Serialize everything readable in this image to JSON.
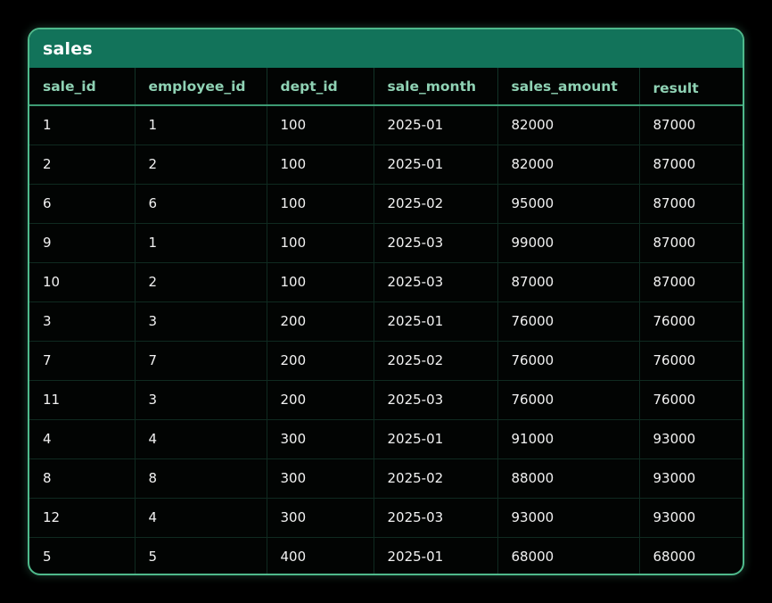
{
  "table": {
    "title": "sales",
    "columns": [
      "sale_id",
      "employee_id",
      "dept_id",
      "sale_month",
      "sales_amount",
      "result"
    ],
    "rows": [
      [
        "1",
        "1",
        "100",
        "2025-01",
        "82000",
        "87000"
      ],
      [
        "2",
        "2",
        "100",
        "2025-01",
        "82000",
        "87000"
      ],
      [
        "6",
        "6",
        "100",
        "2025-02",
        "95000",
        "87000"
      ],
      [
        "9",
        "1",
        "100",
        "2025-03",
        "99000",
        "87000"
      ],
      [
        "10",
        "2",
        "100",
        "2025-03",
        "87000",
        "87000"
      ],
      [
        "3",
        "3",
        "200",
        "2025-01",
        "76000",
        "76000"
      ],
      [
        "7",
        "7",
        "200",
        "2025-02",
        "76000",
        "76000"
      ],
      [
        "11",
        "3",
        "200",
        "2025-03",
        "76000",
        "76000"
      ],
      [
        "4",
        "4",
        "300",
        "2025-01",
        "91000",
        "93000"
      ],
      [
        "8",
        "8",
        "300",
        "2025-02",
        "88000",
        "93000"
      ],
      [
        "12",
        "4",
        "300",
        "2025-03",
        "93000",
        "93000"
      ],
      [
        "5",
        "5",
        "400",
        "2025-01",
        "68000",
        "68000"
      ]
    ]
  },
  "colors": {
    "accent_border": "#4fba8c",
    "title_bar": "#12735a",
    "header_text": "#8fd2b4",
    "cell_text": "#f2f2f2",
    "background": "#000000"
  }
}
